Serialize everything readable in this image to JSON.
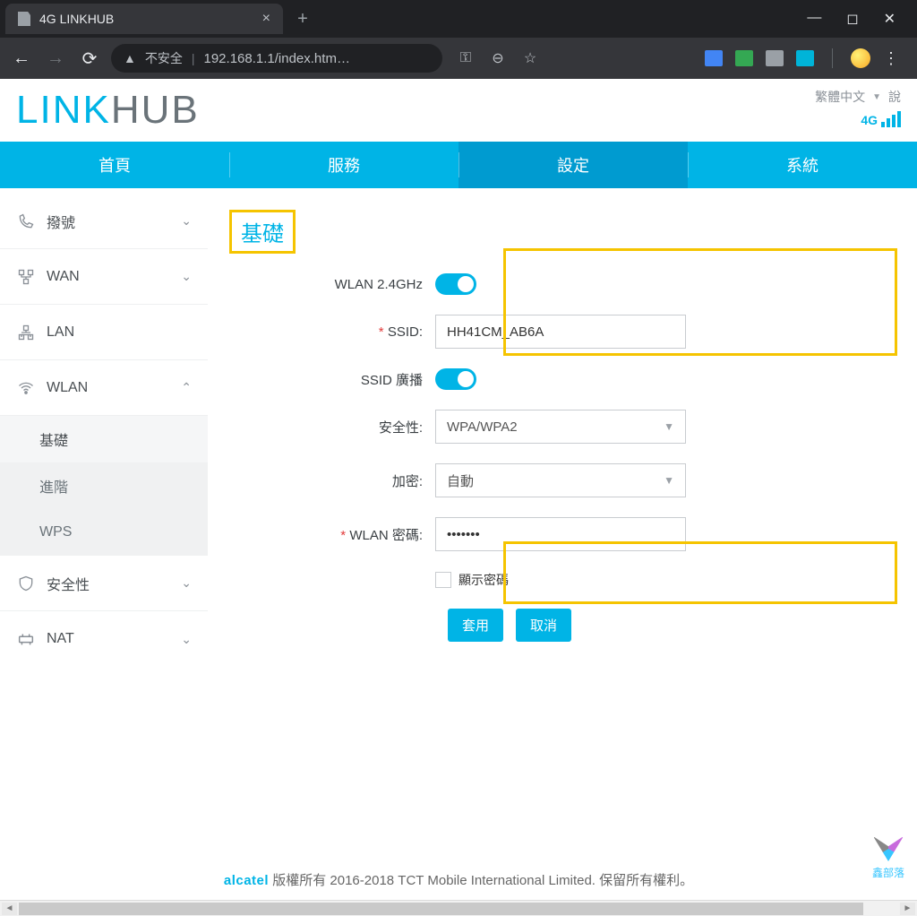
{
  "browser": {
    "tab_title": "4G LINKHUB",
    "url_insecure_label": "不安全",
    "url": "192.168.1.1/index.htm…"
  },
  "header": {
    "logo_part1": "LINK",
    "logo_part2": "HUB",
    "language_label": "繁體中文",
    "help_label": "說",
    "signal_label": "4G"
  },
  "topnav": {
    "home": "首頁",
    "services": "服務",
    "settings": "設定",
    "system": "系統"
  },
  "sidebar": {
    "dial": "撥號",
    "wan": "WAN",
    "lan": "LAN",
    "wlan": "WLAN",
    "wlan_basic": "基礎",
    "wlan_advanced": "進階",
    "wlan_wps": "WPS",
    "security": "安全性",
    "nat": "NAT"
  },
  "section": {
    "title": "基礎"
  },
  "form": {
    "wlan24_label": "WLAN 2.4GHz",
    "ssid_label": "SSID:",
    "ssid_value": "HH41CM_AB6A",
    "ssid_broadcast_label": "SSID 廣播",
    "security_label": "安全性:",
    "security_value": "WPA/WPA2",
    "encryption_label": "加密:",
    "encryption_value": "自動",
    "password_label": "WLAN 密碼:",
    "password_value": "•••••••",
    "show_password_label": "顯示密碼",
    "apply": "套用",
    "cancel": "取消"
  },
  "footer": {
    "brand": "alcatel",
    "copyright": "版權所有 2016-2018 TCT Mobile International Limited. 保留所有權利。"
  },
  "watermark": {
    "text": "鑫部落"
  }
}
